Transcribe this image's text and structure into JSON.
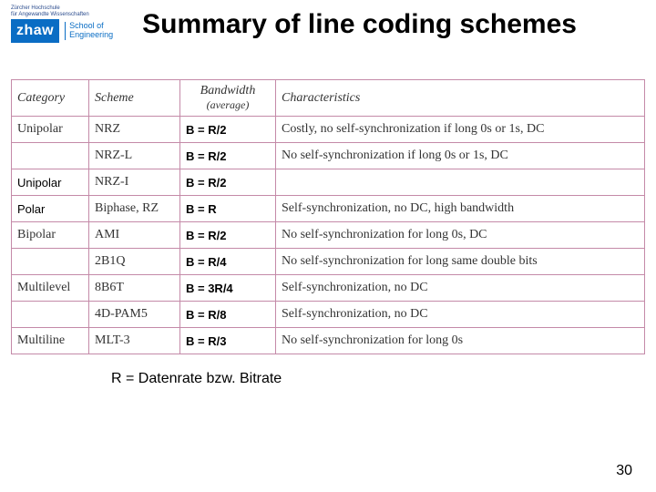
{
  "header": {
    "tiny_line1": "Zürcher Hochschule",
    "tiny_line2": "für Angewandte Wissenschaften",
    "logo_text": "zhaw",
    "school_line1": "School of",
    "school_line2": "Engineering",
    "title": "Summary of line coding schemes"
  },
  "table": {
    "headers": {
      "c1": "Category",
      "c2": "Scheme",
      "c3a": "Bandwidth",
      "c3b": "(average)",
      "c4": "Characteristics"
    },
    "rows": [
      {
        "c1": "Unipolar",
        "c2": "NRZ",
        "c3": "B = R/2",
        "c4": "Costly, no self-synchronization if long 0s or 1s, DC"
      },
      {
        "c1": "",
        "c2": "NRZ-L",
        "c3": "B = R/2",
        "c4": "No self-synchronization if long 0s or 1s, DC"
      },
      {
        "c1": "Unipolar",
        "c2": "NRZ-I",
        "c3": "B = R/2",
        "c4": ""
      },
      {
        "c1": "Polar",
        "c2": "Biphase, RZ",
        "c3": "B = R",
        "c4": "Self-synchronization, no DC, high bandwidth"
      },
      {
        "c1": "Bipolar",
        "c2": "AMI",
        "c3": "B = R/2",
        "c4": "No self-synchronization for long 0s, DC"
      },
      {
        "c1": "",
        "c2": "2B1Q",
        "c3": "B = R/4",
        "c4": "No self-synchronization for long same double bits"
      },
      {
        "c1": "Multilevel",
        "c2": "8B6T",
        "c3": "B = 3R/4",
        "c4": "Self-synchronization, no DC"
      },
      {
        "c1": "",
        "c2": "4D-PAM5",
        "c3": "B = R/8",
        "c4": "Self-synchronization, no DC"
      },
      {
        "c1": "Multiline",
        "c2": "MLT-3",
        "c3": "B = R/3",
        "c4": "No self-synchronization for long 0s"
      }
    ]
  },
  "footnote": "R = Datenrate bzw. Bitrate",
  "page_number": "30"
}
